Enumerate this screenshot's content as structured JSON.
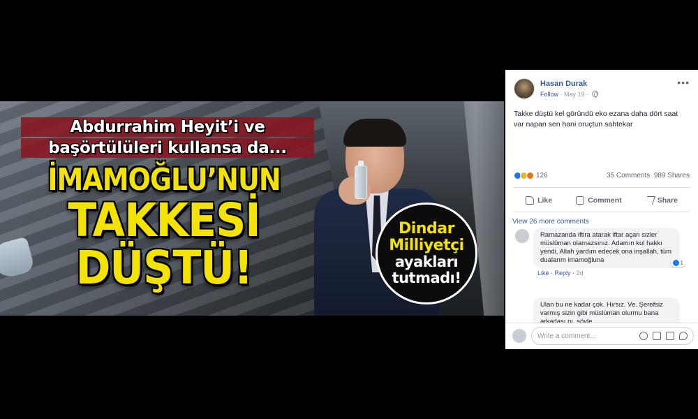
{
  "banner": {
    "headline_top_1": "Abdurrahim Heyit’i ve",
    "headline_top_2": "başörtülüleri kullansa da...",
    "headline_line1": "İMAMOĞLU’NUN",
    "headline_line2": "TAKKESİ",
    "headline_line3": "DÜŞTÜ!",
    "badge_1": "Dindar",
    "badge_2": "Milliyetçi",
    "badge_3": "ayakları",
    "badge_4": "tutmadı!"
  },
  "post": {
    "author": "Hasan Durak",
    "follow": "Follow",
    "date": "May 19",
    "separator": "·",
    "more": "•••",
    "text": "Takke düştü kel göründü eko ezana daha dört saat var napan sen hani oruçtun sahtekar",
    "reaction_count": "126",
    "comments_count": "35 Comments",
    "shares_count": "989 Shares",
    "actions": {
      "like": "Like",
      "comment": "Comment",
      "share": "Share"
    },
    "view_more": "View 26 more comments",
    "comments": [
      {
        "text": "Ramazanda iftira atarak iftar açan sizler müslüman olamazsınız. Adamın kul hakkı yendi, Allah yardım edecek ona inşallah, tüm dualarım imamoğluna",
        "like": "Like",
        "reply": "Reply",
        "time": "2d",
        "reactions": "1"
      },
      {
        "text": "Ulan bu ne kadar çok. Hırsız. Ve. Şerefsiz varmış sizin gibi müslüman olurmu bana arkadaşı nı. söyle"
      }
    ],
    "write_placeholder": "Write a comment..."
  },
  "colors": {
    "fb_link": "#385898",
    "headline_yellow": "#f4e300",
    "headline_red_bar": "#8c141e",
    "like_blue": "#1877f2"
  }
}
